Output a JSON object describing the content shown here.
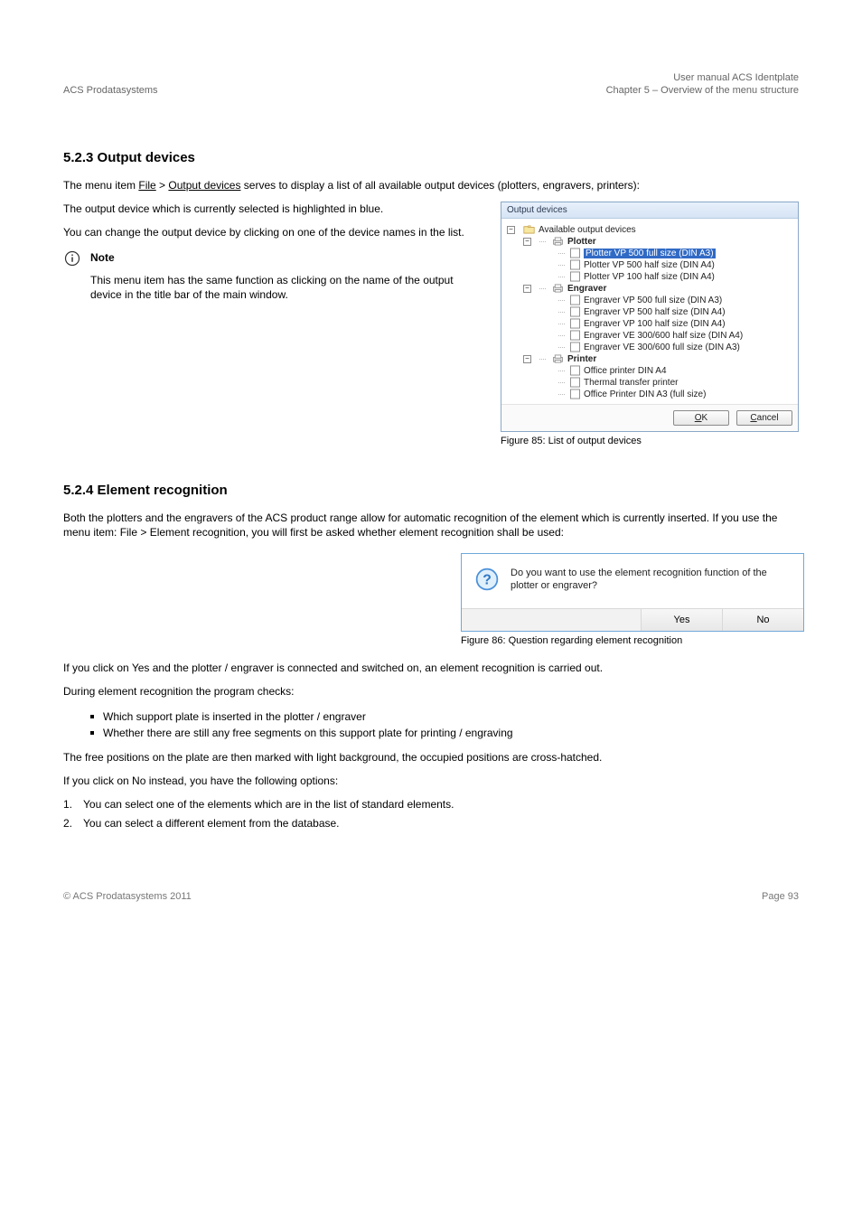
{
  "header": {
    "left": "ACS Prodatasystems",
    "right1": "User manual ACS Identplate",
    "right2": "Chapter 5 – Overview of the menu structure"
  },
  "sections": {
    "s1_title": "5.2.3 Output devices",
    "s1_para1_a": "The menu item ",
    "s1_para1_link1": "File",
    "s1_para1_b": " > ",
    "s1_para1_link2": "Output devices",
    "s1_para1_c": " serves to display a list of all available output devices (plotters, engravers, printers):",
    "s1_left_p1": "The output device which is currently selected is highlighted in blue.",
    "s1_left_p2": "You can change the output device by clicking on one of the device names in the list.",
    "note_label": "Note",
    "note_text": "This menu item has the same function as clicking on the name of the output device in the title bar of the main window.",
    "fig1_caption": "Figure 85: List of output devices",
    "s2_title": "5.2.4 Element recognition",
    "s2_p1": "Both the plotters and the engravers of the ACS product range allow for automatic recognition of the element which is currently inserted. If you use the menu item: File > Element recognition, you will first be asked whether element recognition shall be used:",
    "fig2_caption": "Figure 86: Question regarding element recognition",
    "s2_p2_a": "If you click on ",
    "s2_p2_yes": "Yes",
    "s2_p2_b": " and the plotter / engraver is connected and switched on, an element recognition is carried out.",
    "s2_p3": "During element recognition the program checks:",
    "bullets": {
      "b1": "Which support plate is inserted in the plotter / engraver",
      "b2": "Whether there are still any free segments on this support plate for printing / engraving"
    },
    "s2_p4": "The free positions on the plate are then marked with light background, the occupied positions are cross-hatched.",
    "s2_p5_a": "If you click on ",
    "s2_p5_no": "No",
    "s2_p5_b": " instead, you have the following options:",
    "ol": {
      "n1": "1.",
      "t1": "You can select one of the elements which are in the list of standard elements.",
      "n2": "2.",
      "t2": "You can select a different element from the database."
    }
  },
  "panel": {
    "title": "Output devices",
    "root": "Available output devices",
    "groups": [
      {
        "name": "Plotter",
        "items": [
          {
            "label": "Plotter VP 500 full size (DIN A3)",
            "selected": true
          },
          {
            "label": "Plotter VP 500 half size (DIN A4)",
            "selected": false
          },
          {
            "label": "Plotter VP 100 half size (DIN A4)",
            "selected": false
          }
        ]
      },
      {
        "name": "Engraver",
        "items": [
          {
            "label": "Engraver VP 500 full size (DIN A3)",
            "selected": false
          },
          {
            "label": "Engraver VP 500 half size (DIN A4)",
            "selected": false
          },
          {
            "label": "Engraver VP 100 half size (DIN A4)",
            "selected": false
          },
          {
            "label": "Engraver VE 300/600 half size (DIN A4)",
            "selected": false
          },
          {
            "label": "Engraver VE 300/600 full size (DIN A3)",
            "selected": false
          }
        ]
      },
      {
        "name": "Printer",
        "items": [
          {
            "label": "Office printer DIN A4",
            "selected": false
          },
          {
            "label": "Thermal transfer printer",
            "selected": false
          },
          {
            "label": "Office Printer DIN A3 (full size)",
            "selected": false
          }
        ]
      }
    ],
    "ok": "OK",
    "cancel": "Cancel"
  },
  "msgbox": {
    "text": "Do you want to use the element recognition function of the plotter or engraver?",
    "yes": "Yes",
    "no": "No"
  },
  "footer": {
    "left": "© ACS Prodatasystems 2011",
    "right": "Page 93"
  }
}
